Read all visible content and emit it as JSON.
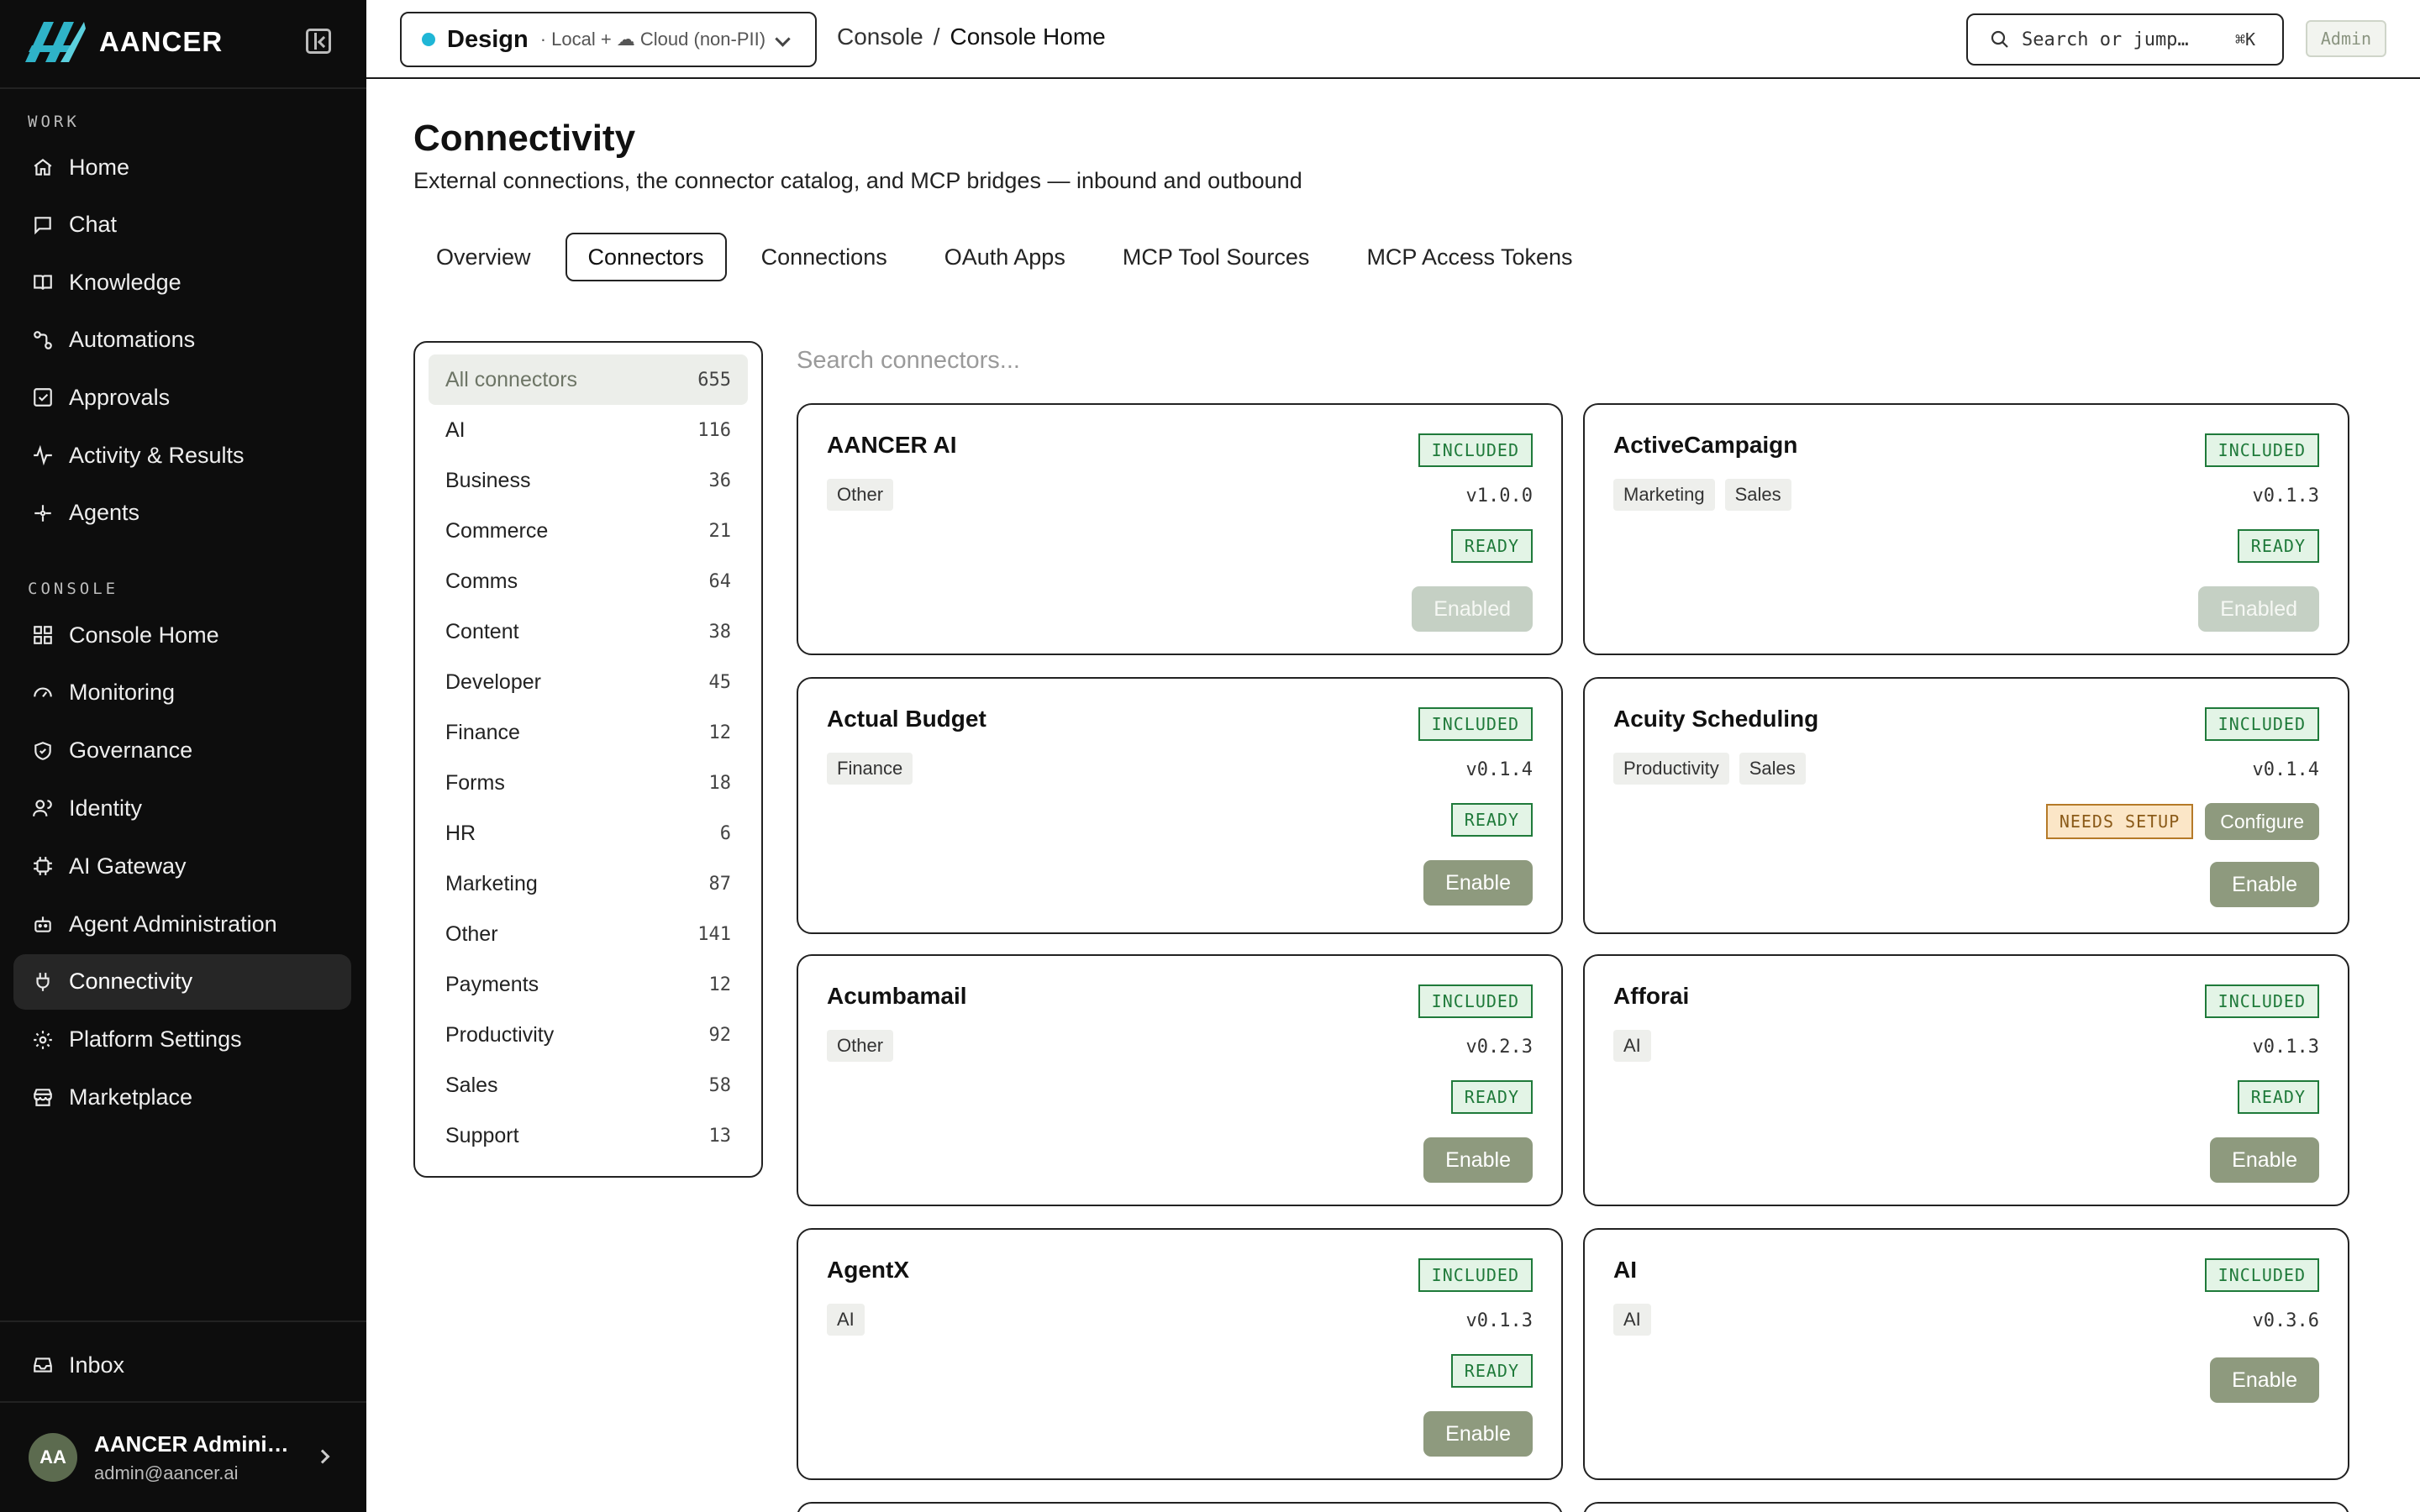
{
  "app": {
    "brand_name": "AANCER",
    "accent": "#8e9a7e",
    "env_dot_color": "#1fb6d6"
  },
  "sidebar": {
    "work_label": "WORK",
    "console_label": "CONSOLE",
    "work_items": [
      {
        "label": "Home",
        "icon": "home-icon"
      },
      {
        "label": "Chat",
        "icon": "chat-icon"
      },
      {
        "label": "Knowledge",
        "icon": "book-icon"
      },
      {
        "label": "Automations",
        "icon": "automation-icon"
      },
      {
        "label": "Approvals",
        "icon": "checkbox-icon"
      },
      {
        "label": "Activity & Results",
        "icon": "activity-icon"
      },
      {
        "label": "Agents",
        "icon": "sparkle-icon"
      }
    ],
    "console_items": [
      {
        "label": "Console Home",
        "icon": "grid-icon"
      },
      {
        "label": "Monitoring",
        "icon": "gauge-icon"
      },
      {
        "label": "Governance",
        "icon": "shield-icon"
      },
      {
        "label": "Identity",
        "icon": "users-icon"
      },
      {
        "label": "AI Gateway",
        "icon": "chip-icon"
      },
      {
        "label": "Agent Administration",
        "icon": "bot-icon"
      },
      {
        "label": "Connectivity",
        "icon": "plug-icon",
        "active": true
      },
      {
        "label": "Platform Settings",
        "icon": "gear-icon"
      },
      {
        "label": "Marketplace",
        "icon": "store-icon"
      }
    ],
    "inbox_label": "Inbox",
    "user": {
      "initials": "AA",
      "name": "AANCER Administr...",
      "email": "admin@aancer.ai"
    }
  },
  "topbar": {
    "env_name": "Design",
    "env_sub": "· Local + ☁ Cloud (non-PII)",
    "breadcrumb_root": "Console",
    "breadcrumb_sep": "/",
    "breadcrumb_current": "Console Home",
    "search_placeholder": "Search or jump…",
    "search_shortcut": "⌘K",
    "role_badge": "Admin"
  },
  "page": {
    "title": "Connectivity",
    "subtitle": "External connections, the connector catalog, and MCP bridges — inbound and outbound",
    "tabs": [
      "Overview",
      "Connectors",
      "Connections",
      "OAuth Apps",
      "MCP Tool Sources",
      "MCP Access Tokens"
    ],
    "active_tab": "Connectors"
  },
  "categories": [
    {
      "label": "All connectors",
      "count": "655",
      "active": true
    },
    {
      "label": "AI",
      "count": "116"
    },
    {
      "label": "Business",
      "count": "36"
    },
    {
      "label": "Commerce",
      "count": "21"
    },
    {
      "label": "Comms",
      "count": "64"
    },
    {
      "label": "Content",
      "count": "38"
    },
    {
      "label": "Developer",
      "count": "45"
    },
    {
      "label": "Finance",
      "count": "12"
    },
    {
      "label": "Forms",
      "count": "18"
    },
    {
      "label": "HR",
      "count": "6"
    },
    {
      "label": "Marketing",
      "count": "87"
    },
    {
      "label": "Other",
      "count": "141"
    },
    {
      "label": "Payments",
      "count": "12"
    },
    {
      "label": "Productivity",
      "count": "92"
    },
    {
      "label": "Sales",
      "count": "58"
    },
    {
      "label": "Support",
      "count": "13"
    }
  ],
  "connector_search_placeholder": "Search connectors...",
  "connectors": [
    {
      "name": "AANCER AI",
      "tags": [
        "Other"
      ],
      "version": "v1.0.0",
      "included": "INCLUDED",
      "status": "READY",
      "action": "Enabled",
      "enabled": true
    },
    {
      "name": "ActiveCampaign",
      "tags": [
        "Marketing",
        "Sales"
      ],
      "version": "v0.1.3",
      "included": "INCLUDED",
      "status": "READY",
      "action": "Enabled",
      "enabled": true
    },
    {
      "name": "Actual Budget",
      "tags": [
        "Finance"
      ],
      "version": "v0.1.4",
      "included": "INCLUDED",
      "status": "READY",
      "action": "Enable"
    },
    {
      "name": "Acuity Scheduling",
      "tags": [
        "Productivity",
        "Sales"
      ],
      "version": "v0.1.4",
      "included": "INCLUDED",
      "status": "NEEDS SETUP",
      "configure": "Configure",
      "action": "Enable"
    },
    {
      "name": "Acumbamail",
      "tags": [
        "Other"
      ],
      "version": "v0.2.3",
      "included": "INCLUDED",
      "status": "READY",
      "action": "Enable"
    },
    {
      "name": "Afforai",
      "tags": [
        "AI"
      ],
      "version": "v0.1.3",
      "included": "INCLUDED",
      "status": "READY",
      "action": "Enable"
    },
    {
      "name": "AgentX",
      "tags": [
        "AI"
      ],
      "version": "v0.1.3",
      "included": "INCLUDED",
      "status": "READY",
      "action": "Enable"
    },
    {
      "name": "AI",
      "tags": [
        "AI"
      ],
      "version": "v0.3.6",
      "included": "INCLUDED",
      "status": "",
      "action": "Enable"
    }
  ]
}
